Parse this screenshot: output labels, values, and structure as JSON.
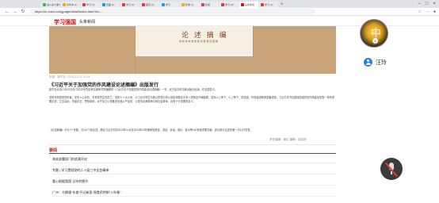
{
  "browser": {
    "tabs": [
      {
        "label": "进入第十章/1",
        "color": "#4caf50"
      },
      {
        "label": "文件夹 (1)",
        "color": "#f5a623"
      },
      {
        "label": "学习 (1)",
        "color": "#e53935"
      },
      {
        "label": "页面 (1)",
        "color": "#2196f3"
      },
      {
        "label": "学习 (2)",
        "color": "#e53935"
      },
      {
        "label": "首页 (1)",
        "color": "#e53935"
      },
      {
        "label": "学习",
        "color": "#2196f3"
      },
      {
        "label": "作者 (1)",
        "color": "#f5a623"
      },
      {
        "label": "新闻",
        "color": "#e53935"
      },
      {
        "label": "学习 (3)",
        "color": "#e53935"
      },
      {
        "label": "头条新闻",
        "color": "#c8161d"
      },
      {
        "label": "学习 (4)",
        "color": "#e53935"
      }
    ],
    "url": "https://m.xuexi.cn/lgpage/detail/index.html?id=..."
  },
  "site": {
    "logo": "学习强国",
    "section": "头条新闻"
  },
  "banner": {
    "book_title": "论 述 摘 编",
    "book_subtitle": "中 共 中 央 党 史 和 文 献 研 究 院 编"
  },
  "article": {
    "meta": "来源：新华社 | 2024-12-12 10:04",
    "headline": "《习近平关于加强党的作风建设论述摘编》出版发行",
    "p1": "新华社北京12月12日电 中共中央党史和文献研究院编辑的《习近平关于加强党的作风建设论述摘编》一书，近日由中央文献出版社出版，在全国发行。",
    "p2": "党的作风是党的形象，关系人心向背，关系党的生死存亡。党的十八大以来，以习近平同志为核心的党中央从制定和落实中央八项规定开局破题，坚持以上率下，以上率下、抓关键，作风建设取得显著成效。习近平总书记围绕加强党的作风建设发表一系列重要论述，立意高远，内涵丰富，思想深刻，对于持之以恒推进全面从严治党，以党的自我革命引领社会革命，具有十分重要的意义。",
    "p3": "《论述摘编》分为7个专题，共计277段论述，摘自习近平同志2012年11月至2024年10月期间的报告、讲话、谈话、指示、批示等160多篇重要文献。其中部分论述是第一次公开发表。",
    "editor": "责任编辑：周红 编辑：张佳林"
  },
  "related": {
    "title": "要闻",
    "items": [
      "海关部署部门的浪潮开启",
      "专题 | 学习贯彻党的二十届三中全会精神",
      "重心根据我国 记牢的细节",
      "广州：大柳塘“东坡”开迁新居 保食民特制“入伙餐”"
    ]
  },
  "overlay": {
    "logo_glyph": "中",
    "badge": "1",
    "user_name": "汪玲"
  }
}
